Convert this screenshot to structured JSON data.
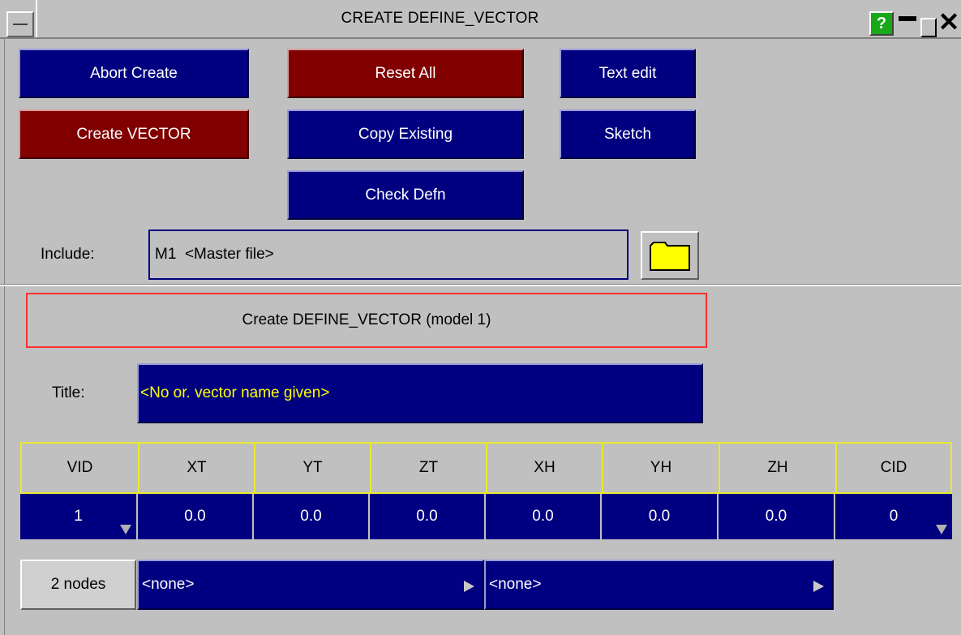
{
  "window": {
    "title": "CREATE DEFINE_VECTOR",
    "help_label": "?",
    "close_label": "✕"
  },
  "toolbar": {
    "abort_create": "Abort Create",
    "reset_all": "Reset All",
    "text_edit": "Text edit",
    "create_vector": "Create VECTOR",
    "copy_existing": "Copy Existing",
    "sketch": "Sketch",
    "check_defn": "Check Defn"
  },
  "include": {
    "label": "Include:",
    "value": "M1  <Master file>",
    "folder_icon": "folder-icon"
  },
  "header": {
    "text": "Create DEFINE_VECTOR (model 1)"
  },
  "title_field": {
    "label": "Title:",
    "value": "<No or. vector name given>"
  },
  "grid": {
    "columns": [
      "VID",
      "XT",
      "YT",
      "ZT",
      "XH",
      "YH",
      "ZH",
      "CID"
    ],
    "values": [
      "1",
      "0.0",
      "0.0",
      "0.0",
      "0.0",
      "0.0",
      "0.0",
      "0"
    ]
  },
  "nodes": {
    "button_label": "2 nodes",
    "node1": "<none>",
    "node2": "<none>"
  },
  "colors": {
    "button_blue": "#000080",
    "button_red": "#800000",
    "title_text": "#ffff00",
    "grid_border": "#e8e830",
    "header_border": "#ff3030"
  }
}
